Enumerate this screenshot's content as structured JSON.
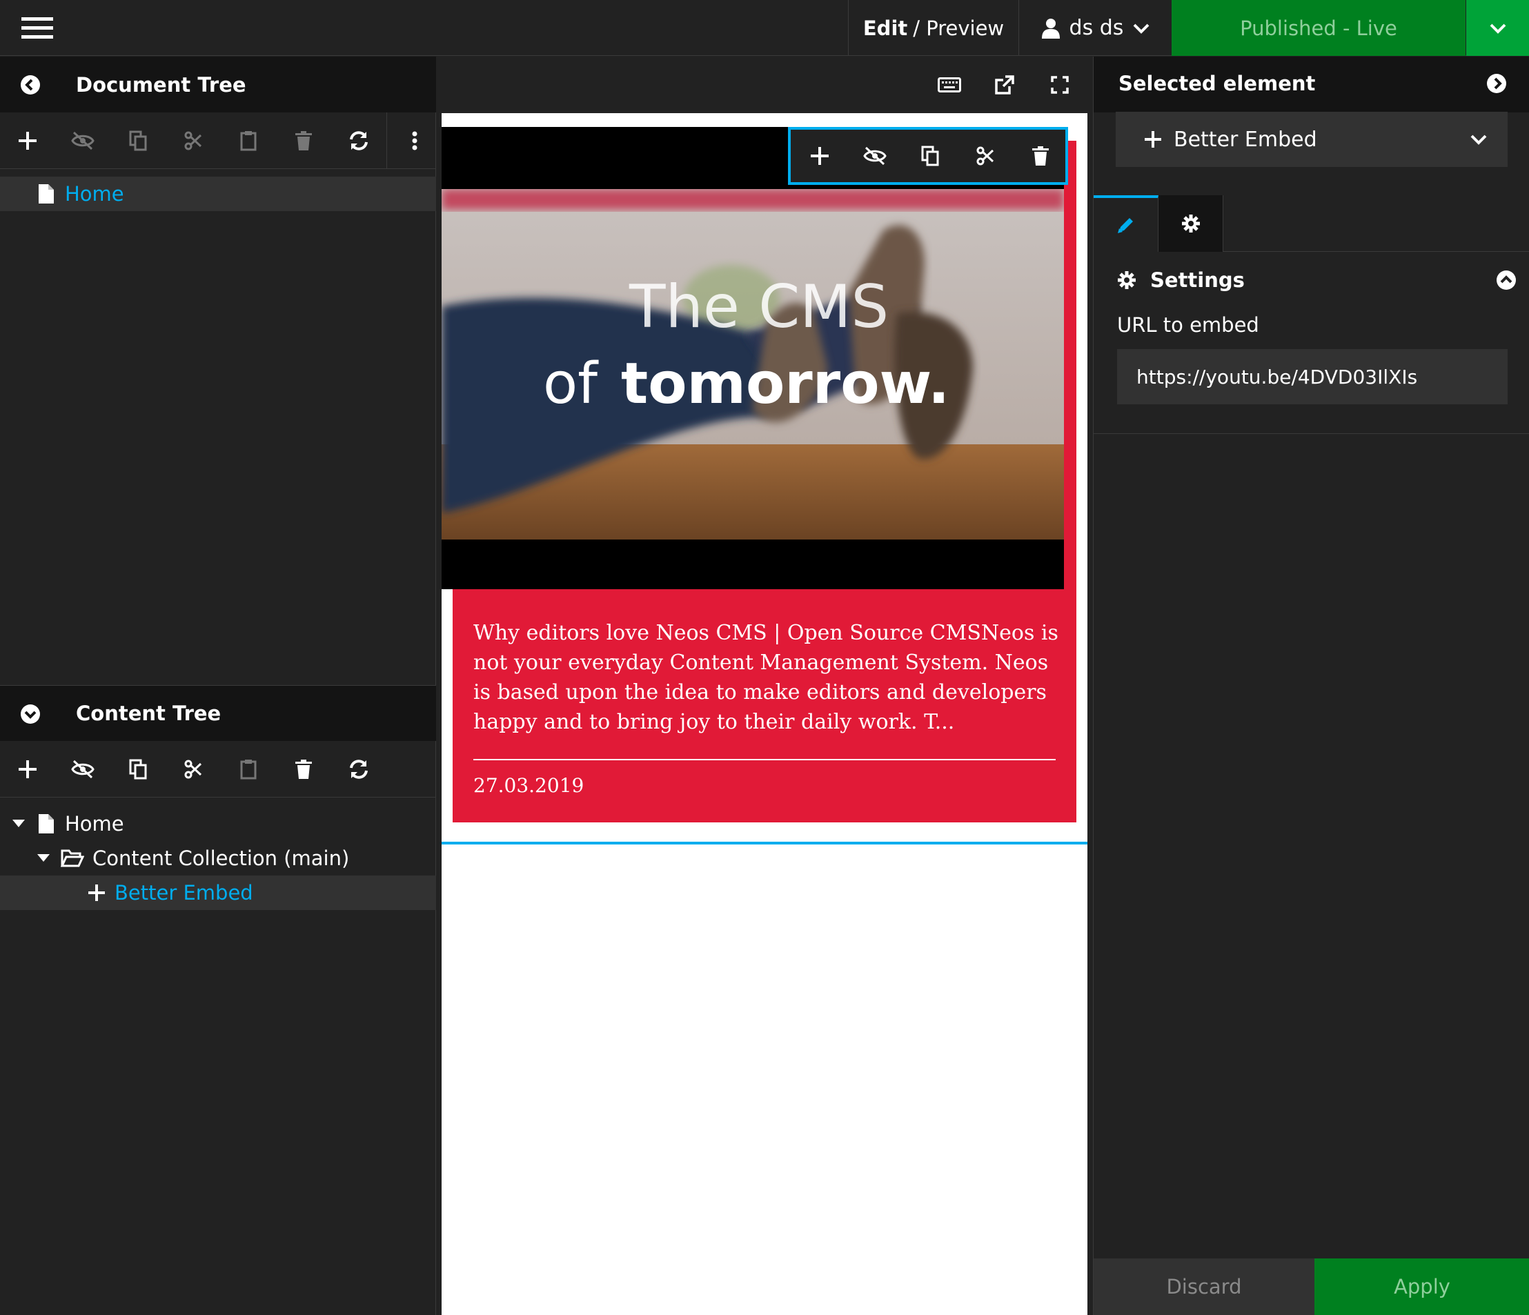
{
  "topbar": {
    "edit_mode": "Edit",
    "edit_separator": "/ Preview",
    "user_name": "ds ds",
    "publish_label": "Published - Live"
  },
  "document_tree": {
    "title": "Document Tree",
    "items": [
      {
        "label": "Home",
        "icon": "file-icon",
        "active": true
      }
    ]
  },
  "content_tree": {
    "title": "Content Tree",
    "items": [
      {
        "label": "Home",
        "icon": "file-icon"
      },
      {
        "label": "Content Collection (main)",
        "icon": "folder-open-icon"
      },
      {
        "label": "Better Embed",
        "icon": "plus-icon",
        "active": true
      }
    ]
  },
  "canvas": {
    "video_title_line1": "The CMS",
    "video_title_of": "of",
    "video_title_bold": "tomorrow.",
    "card_text": "Why editors love Neos CMS | Open Source CMSNeos is not your everyday Content Management System. Neos is based upon the idea to make editors and developers happy and to bring joy to their daily work. T...",
    "card_date": "27.03.2019"
  },
  "inspector": {
    "title": "Selected element",
    "node_type": "Better Embed",
    "group_label": "Settings",
    "url_label": "URL to embed",
    "url_value": "https://youtu.be/4DVD03IlXIs",
    "discard_label": "Discard",
    "apply_label": "Apply"
  },
  "colors": {
    "accent_blue": "#00adee",
    "publish_green": "#00801f",
    "card_red": "#e11a37"
  }
}
